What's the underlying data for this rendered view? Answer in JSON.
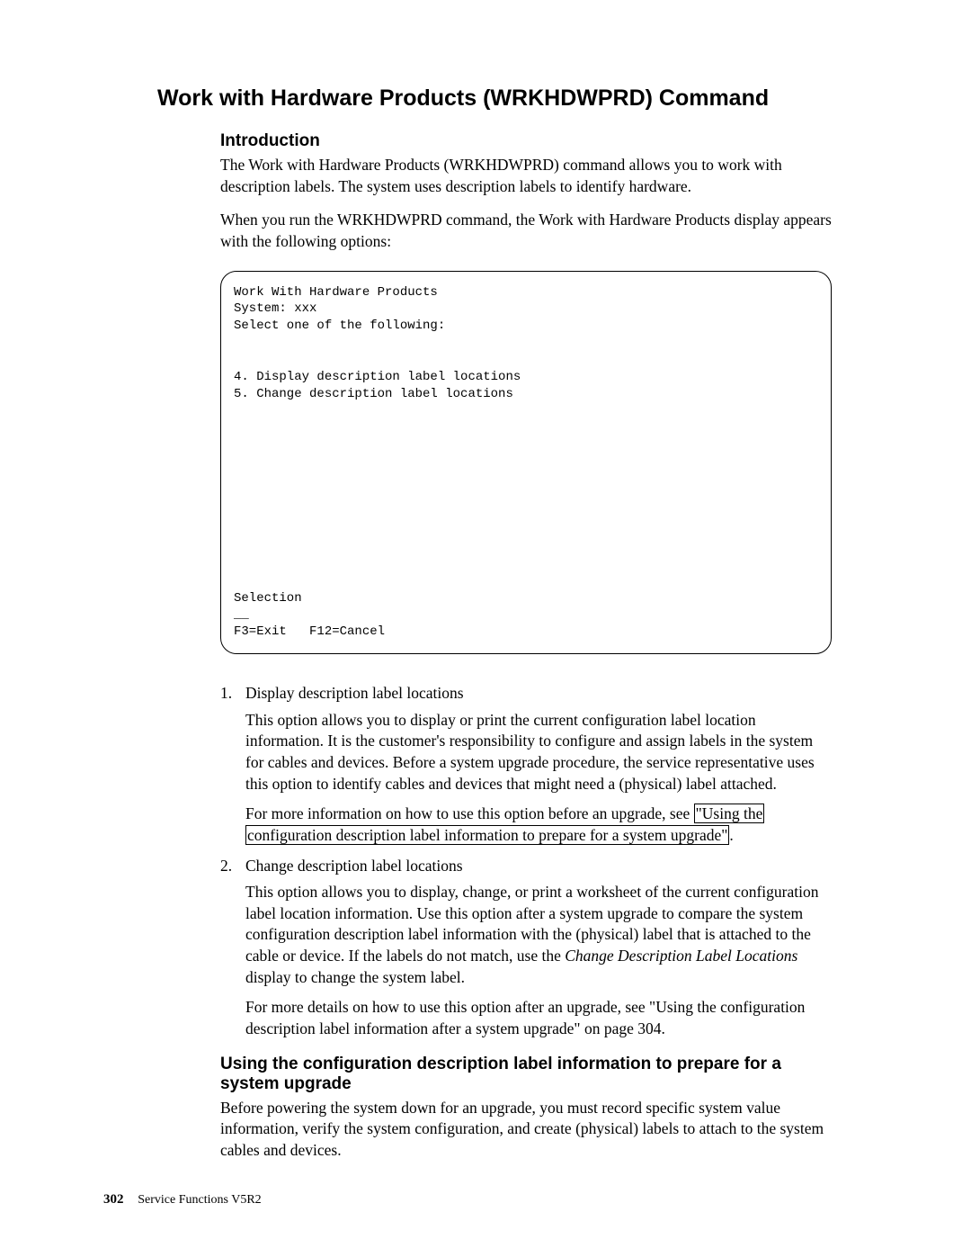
{
  "main_heading": "Work with Hardware Products (WRKHDWPRD) Command",
  "intro": {
    "heading": "Introduction",
    "p1": "The Work with Hardware Products (WRKHDWPRD) command allows you to work with description labels. The system uses description labels to identify hardware.",
    "p2": "When you run the WRKHDWPRD command, the Work with Hardware Products display appears with the following options:"
  },
  "terminal": "Work With Hardware Products\nSystem: xxx\nSelect one of the following:\n\n\n4. Display description label locations\n5. Change description label locations\n\n\n\n\n\n\n\n\n\n\n\nSelection\n__\nF3=Exit   F12=Cancel",
  "list": {
    "item1": {
      "head": "Display description label locations",
      "p1": "This option allows you to display or print the current configuration label location information. It is the customer's responsibility to configure and assign labels in the system for cables and devices. Before a system upgrade procedure, the service representative uses this option to identify cables and devices that might need a (physical) label attached.",
      "p2_pre": "For more information on how to use this option before an upgrade, see ",
      "p2_link": "\"Using the configuration description label information to prepare for a system upgrade\"",
      "p2_post": "."
    },
    "item2": {
      "head": "Change description label locations",
      "p1_pre": "This option allows you to display, change, or print a worksheet of the current configuration label location information. Use this option after a system upgrade to compare the system configuration description label information with the (physical) label that is attached to the cable or device. If the labels do not match, use the ",
      "p1_italic": "Change Description Label Locations",
      "p1_post": " display to change the system label.",
      "p2": "For more details on how to use this option after an upgrade, see \"Using the configuration description label information after a system upgrade\" on page 304."
    }
  },
  "section2": {
    "heading": "Using the configuration description label information to prepare for a system upgrade",
    "p1": "Before powering the system down for an upgrade, you must record specific system value information, verify the system configuration, and create (physical) labels to attach to the system cables and devices."
  },
  "footer": {
    "page_number": "302",
    "label": "Service Functions V5R2"
  }
}
